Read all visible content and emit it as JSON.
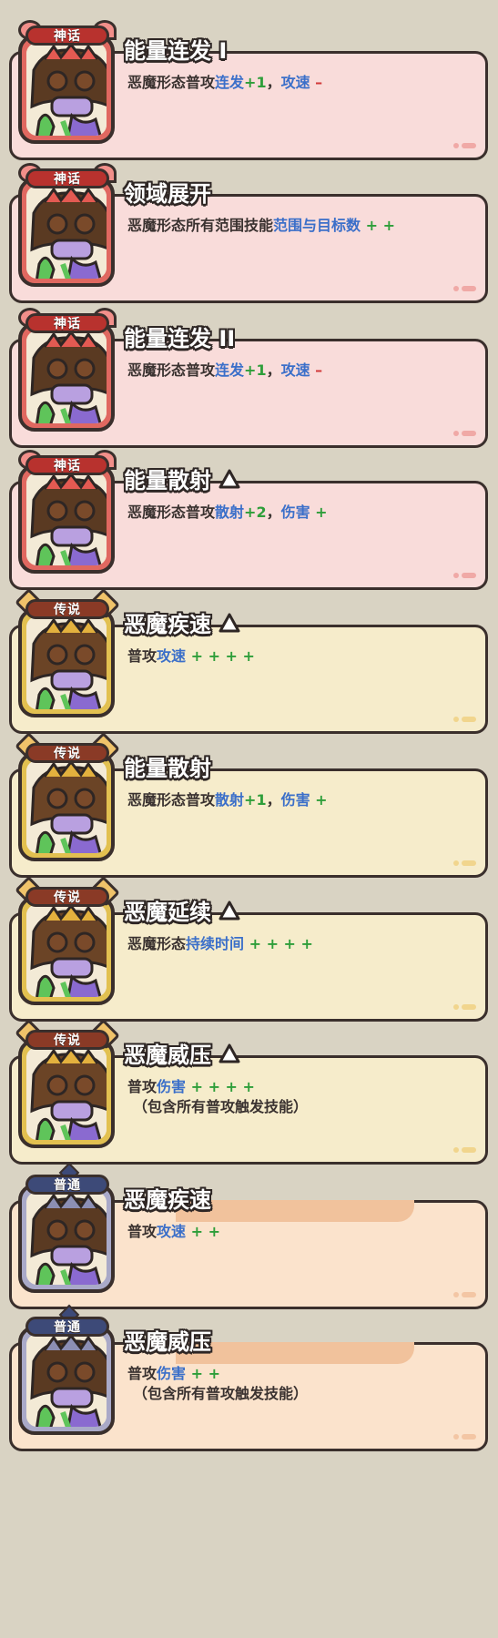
{
  "cards": [
    {
      "rarity": "mythic",
      "badge": "神话",
      "title": "能量连发 I",
      "has_triangle": false,
      "desc_a": "恶魔形态普攻",
      "hl_b": "连发",
      "g_c": "+1",
      "sep_d": "，",
      "hl_e": "攻速",
      "tail": " –",
      "tail_color": "red",
      "note": ""
    },
    {
      "rarity": "mythic",
      "badge": "神话",
      "title": "领域展开",
      "has_triangle": false,
      "desc_a": "恶魔形态所有范围技能",
      "hl_b": "范围与目标数",
      "g_c": " + +",
      "sep_d": "",
      "hl_e": "",
      "tail": "",
      "tail_color": "green",
      "note": ""
    },
    {
      "rarity": "mythic",
      "badge": "神话",
      "title": "能量连发 II",
      "has_triangle": false,
      "desc_a": "恶魔形态普攻",
      "hl_b": "连发",
      "g_c": "+1",
      "sep_d": "，",
      "hl_e": "攻速",
      "tail": " –",
      "tail_color": "red",
      "note": ""
    },
    {
      "rarity": "mythic",
      "badge": "神话",
      "title": "能量散射",
      "has_triangle": true,
      "desc_a": "恶魔形态普攻",
      "hl_b": "散射",
      "g_c": "+2",
      "sep_d": "，",
      "hl_e": "伤害",
      "tail": " +",
      "tail_color": "green",
      "note": ""
    },
    {
      "rarity": "legend",
      "badge": "传说",
      "title": "恶魔疾速",
      "has_triangle": true,
      "desc_a": "普攻",
      "hl_b": "攻速",
      "g_c": " + + + +",
      "sep_d": "",
      "hl_e": "",
      "tail": "",
      "tail_color": "green",
      "note": ""
    },
    {
      "rarity": "legend",
      "badge": "传说",
      "title": "能量散射",
      "has_triangle": false,
      "desc_a": "恶魔形态普攻",
      "hl_b": "散射",
      "g_c": "+1",
      "sep_d": "，",
      "hl_e": "伤害",
      "tail": " +",
      "tail_color": "green",
      "note": ""
    },
    {
      "rarity": "legend",
      "badge": "传说",
      "title": "恶魔延续",
      "has_triangle": true,
      "desc_a": "恶魔形态",
      "hl_b": "持续时间",
      "g_c": " + + + +",
      "sep_d": "",
      "hl_e": "",
      "tail": "",
      "tail_color": "green",
      "note": ""
    },
    {
      "rarity": "legend",
      "badge": "传说",
      "title": "恶魔威压",
      "has_triangle": true,
      "desc_a": "普攻",
      "hl_b": "伤害",
      "g_c": " + + + +",
      "sep_d": "",
      "hl_e": "",
      "tail": "",
      "tail_color": "green",
      "note": "（包含所有普攻触发技能）"
    },
    {
      "rarity": "normal",
      "badge": "普通",
      "title": "恶魔疾速",
      "has_triangle": false,
      "desc_a": "普攻",
      "hl_b": "攻速",
      "g_c": " + +",
      "sep_d": "",
      "hl_e": "",
      "tail": "",
      "tail_color": "green",
      "note": ""
    },
    {
      "rarity": "normal",
      "badge": "普通",
      "title": "恶魔威压",
      "has_triangle": false,
      "desc_a": "普攻",
      "hl_b": "伤害",
      "g_c": " + +",
      "sep_d": "",
      "hl_e": "",
      "tail": "",
      "tail_color": "green",
      "note": "（包含所有普攻触发技能）"
    }
  ],
  "colors": {
    "mythic_card": "#f9dcda",
    "legend_card": "#f6eccb",
    "normal_card": "#fbe3cc",
    "highlight_blue": "#3b6fc9",
    "plus_green": "#2e9e3a",
    "minus_red": "#d23a3a"
  },
  "icons": {
    "triangle": "white-triangle-icon",
    "portrait": "demon-hero-portrait"
  }
}
